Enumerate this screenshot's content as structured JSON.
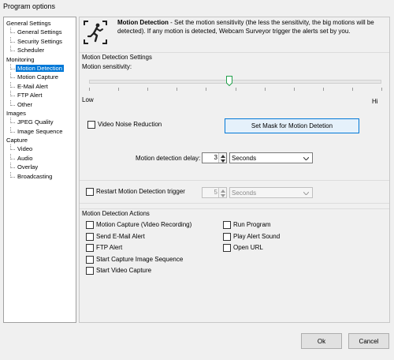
{
  "window": {
    "title": "Program options"
  },
  "tree": {
    "items": [
      {
        "label": "General Settings",
        "level": 0,
        "selected": false
      },
      {
        "label": "General Settings",
        "level": 1,
        "selected": false
      },
      {
        "label": "Security Settings",
        "level": 1,
        "selected": false
      },
      {
        "label": "Scheduler",
        "level": 1,
        "selected": false
      },
      {
        "label": "Monitoring",
        "level": 0,
        "selected": false
      },
      {
        "label": "Motion Detection",
        "level": 1,
        "selected": true
      },
      {
        "label": "Motion Capture",
        "level": 1,
        "selected": false
      },
      {
        "label": "E-Mail Alert",
        "level": 1,
        "selected": false
      },
      {
        "label": "FTP Alert",
        "level": 1,
        "selected": false
      },
      {
        "label": "Other",
        "level": 1,
        "selected": false
      },
      {
        "label": "Images",
        "level": 0,
        "selected": false
      },
      {
        "label": "JPEG Quality",
        "level": 1,
        "selected": false
      },
      {
        "label": "Image Sequence",
        "level": 1,
        "selected": false
      },
      {
        "label": "Capture",
        "level": 0,
        "selected": false
      },
      {
        "label": "Video",
        "level": 1,
        "selected": false
      },
      {
        "label": "Audio",
        "level": 1,
        "selected": false
      },
      {
        "label": "Overlay",
        "level": 1,
        "selected": false
      },
      {
        "label": "Broadcasting",
        "level": 1,
        "selected": false
      }
    ]
  },
  "header": {
    "icon": "motion-figure-icon",
    "bold": "Motion Detection",
    "text": " - Set the motion sensitivity (the less the sensitivity, the big motions will be detected). If any motion is detected, Webcam Surveyor trigger the alerts set by you."
  },
  "settings": {
    "section_title": "Motion Detection Settings",
    "sensitivity_label": "Motion sensitivity:",
    "sensitivity_value": 0.48,
    "low_label": "Low",
    "high_label": "Hi",
    "noise_reduction_label": "Video Noise Reduction",
    "noise_reduction_checked": false,
    "mask_button": "Set Mask for Motion Detetion",
    "delay_label": "Motion detection delay:",
    "delay_value": "3",
    "delay_unit": "Seconds"
  },
  "restart": {
    "label": "Restart Motion Detection trigger",
    "checked": false,
    "value": "5",
    "unit": "Seconds"
  },
  "actions": {
    "section_title": "Motion Detection Actions",
    "left": [
      "Motion Capture (Video Recording)",
      "Send E-Mail  Alert",
      "FTP Alert",
      "Start Capture Image Sequence",
      "Start Video Capture"
    ],
    "right": [
      "Run Program",
      "Play Alert Sound",
      "Open URL"
    ]
  },
  "footer": {
    "ok": "Ok",
    "cancel": "Cancel"
  },
  "colors": {
    "selection": "#0078d7",
    "accent_button_bg": "#e5f1fb",
    "thumb": "#22a04b"
  }
}
